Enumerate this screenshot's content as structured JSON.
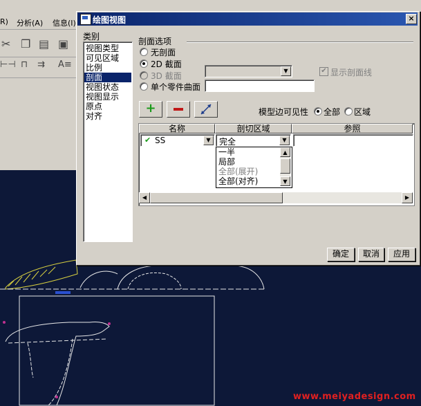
{
  "background_app": {
    "menus": [
      {
        "label": "R)"
      },
      {
        "label": "分析(A)"
      },
      {
        "label": "信息(I)"
      }
    ]
  },
  "dialog": {
    "title": "绘图视图",
    "close_label": "×",
    "category_label": "类别",
    "categories": [
      {
        "label": "视图类型",
        "selected": false
      },
      {
        "label": "可见区域",
        "selected": false
      },
      {
        "label": "比例",
        "selected": false
      },
      {
        "label": "剖面",
        "selected": true
      },
      {
        "label": "视图状态",
        "selected": false
      },
      {
        "label": "视图显示",
        "selected": false
      },
      {
        "label": "原点",
        "selected": false
      },
      {
        "label": "对齐",
        "selected": false
      }
    ],
    "section_options": {
      "group_label": "剖面选项",
      "radios": [
        {
          "label": "无剖面",
          "checked": false,
          "enabled": true
        },
        {
          "label": "2D 截面",
          "checked": true,
          "enabled": true
        },
        {
          "label": "3D 截面",
          "checked": false,
          "enabled": false
        },
        {
          "label": "单个零件曲面",
          "checked": false,
          "enabled": true
        }
      ],
      "show_hatch_label": "显示剖面线",
      "show_hatch_checked": true
    },
    "model_edge_visibility": {
      "label": "模型边可见性",
      "options": [
        {
          "label": "全部",
          "checked": true
        },
        {
          "label": "区域",
          "checked": false
        }
      ]
    },
    "table": {
      "columns": [
        "名称",
        "剖切区域",
        "参照"
      ],
      "rows": [
        {
          "name": "SS",
          "area": "完全",
          "reference": ""
        }
      ]
    },
    "area_dropdown_options": [
      "一半",
      "局部",
      "全部(展开)",
      "全部(对齐)"
    ],
    "buttons": {
      "ok": "确定",
      "cancel": "取消",
      "apply": "应用"
    },
    "colors": {
      "title_bar": "#0a246a",
      "selection": "#0a246a",
      "add_icon": "#1a9a1a",
      "remove_icon": "#c01818"
    }
  },
  "watermark": "www.meiyadesign.com"
}
